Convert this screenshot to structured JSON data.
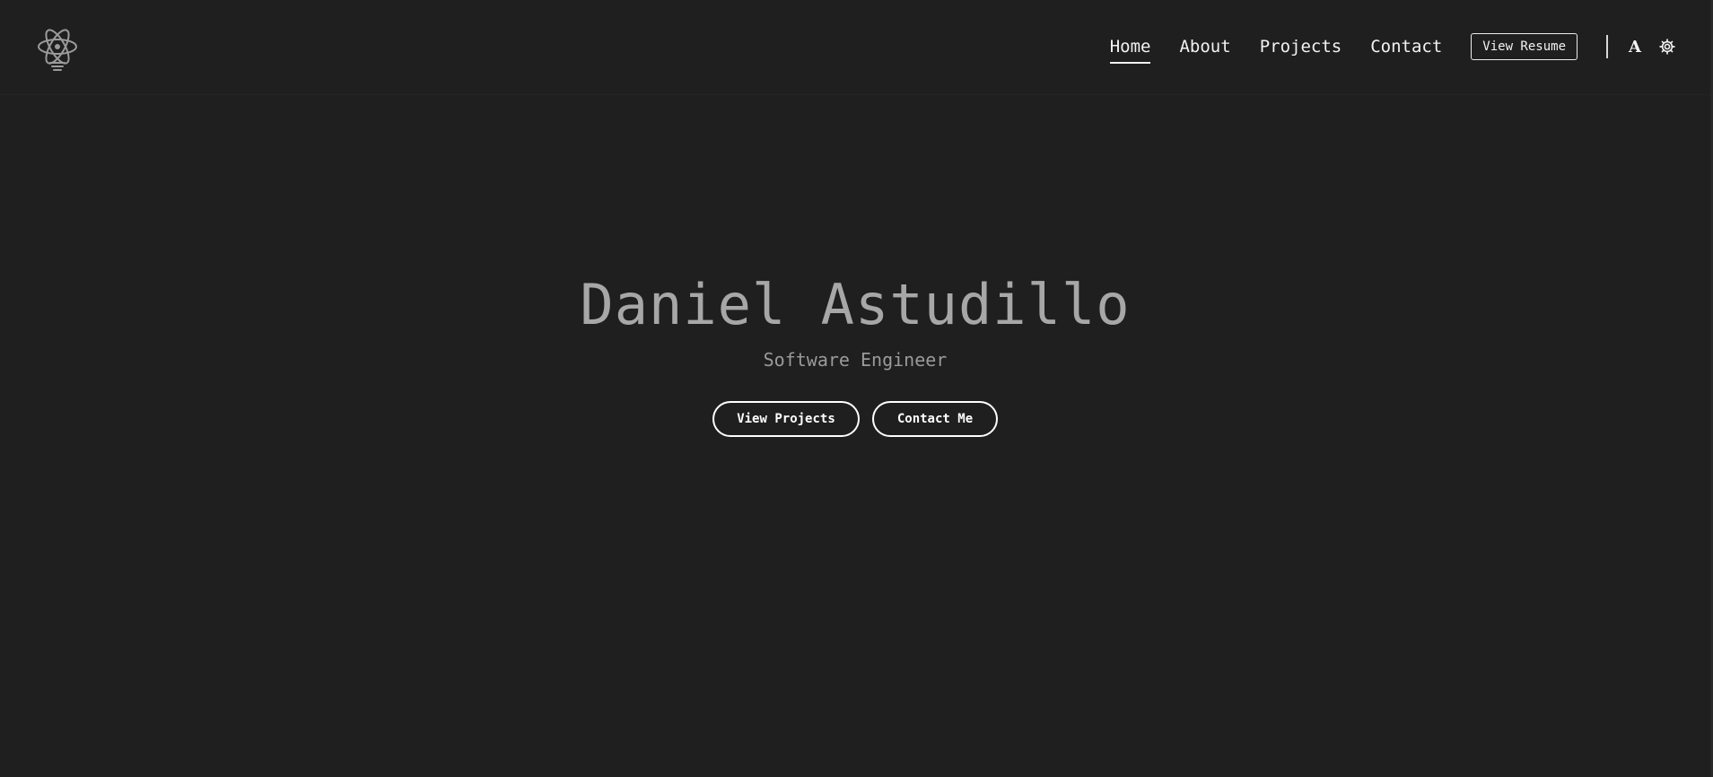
{
  "header": {
    "logo_icon": "atom-lightbulb-icon",
    "nav": [
      {
        "label": "Home",
        "active": true
      },
      {
        "label": "About",
        "active": false
      },
      {
        "label": "Projects",
        "active": false
      },
      {
        "label": "Contact",
        "active": false
      }
    ],
    "resume_label": "View Resume",
    "font_toggle_icon": "font-toggle-icon",
    "font_toggle_glyph": "A",
    "theme_toggle_icon": "gear-icon"
  },
  "hero": {
    "name": "Daniel Astudillo",
    "role": "Software Engineer",
    "primary_button": "View Projects",
    "secondary_button": "Contact Me"
  },
  "colors": {
    "background": "#1f1f1f",
    "name_text": "#a7a7a7",
    "role_text": "#9a9a9a",
    "nav_text": "#f2f2f2",
    "button_border": "#ffffff"
  }
}
